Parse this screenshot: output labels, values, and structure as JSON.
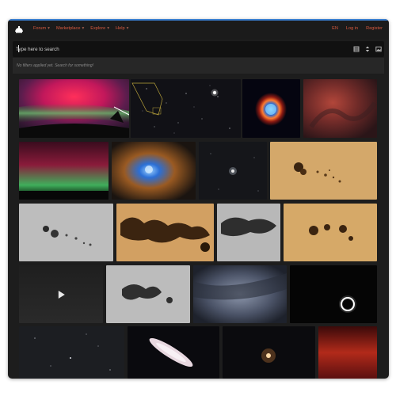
{
  "nav": {
    "menu": [
      {
        "label": "Forum"
      },
      {
        "label": "Marketplace"
      },
      {
        "label": "Explore"
      },
      {
        "label": "Help"
      }
    ],
    "right": {
      "language": "EN",
      "login": "Log in",
      "register": "Register"
    }
  },
  "search": {
    "placeholder": "Type here to search"
  },
  "filters": {
    "message": "No filters applied yet. Search for something!"
  },
  "colors": {
    "accent": "#d9593f",
    "bg": "#1d1d1d",
    "bar": "#111111"
  },
  "icons": [
    "logo-icon",
    "grid-icon",
    "sort-icon",
    "image-icon",
    "play-icon"
  ],
  "gallery": [
    {
      "name": "aurora-fisheye"
    },
    {
      "name": "star-field-chart"
    },
    {
      "name": "bright-star"
    },
    {
      "name": "helix-nebula"
    },
    {
      "name": "red-nebula"
    },
    {
      "name": "aurora-horizon"
    },
    {
      "name": "blue-nebula"
    },
    {
      "name": "faint-galaxy"
    },
    {
      "name": "sunspot-orange"
    },
    {
      "name": "sunspot-gray"
    },
    {
      "name": "sunspot-orange-large"
    },
    {
      "name": "sunspot-gray-close"
    },
    {
      "name": "sunspot-orange-close"
    },
    {
      "name": "night-video"
    },
    {
      "name": "sunspot-gray-group"
    },
    {
      "name": "milky-way-cloud"
    },
    {
      "name": "solar-eclipse"
    },
    {
      "name": "star-field"
    },
    {
      "name": "edge-on-galaxy"
    },
    {
      "name": "galaxy-core"
    },
    {
      "name": "red-aurora"
    }
  ]
}
